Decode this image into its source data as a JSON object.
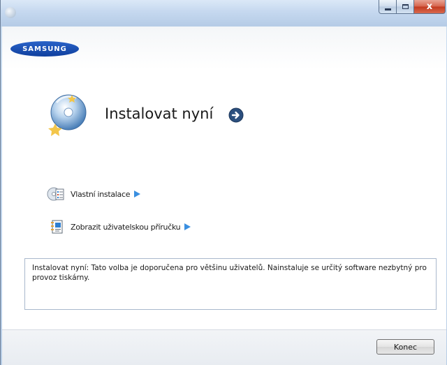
{
  "window": {
    "controls": {
      "minimize_icon": "minimize-icon",
      "maximize_icon": "maximize-icon",
      "close_label": "x"
    }
  },
  "brand": {
    "logo_text": "SAMSUNG"
  },
  "install": {
    "title": "Instalovat nyní"
  },
  "options": [
    {
      "label": "Vlastní instalace",
      "icon": "cd-settings-icon"
    },
    {
      "label": "Zobrazit uživatelskou příručku",
      "icon": "user-guide-icon"
    }
  ],
  "description": "Instalovat nyní: Tato volba je doporučena pro většinu uživatelů. Nainstaluje se určitý software nezbytný pro provoz tiskárny.",
  "footer": {
    "close_button": "Konec"
  },
  "colors": {
    "accent_blue": "#3a8fe0",
    "logo_blue": "#1a4fb5",
    "close_red": "#c2391f"
  }
}
